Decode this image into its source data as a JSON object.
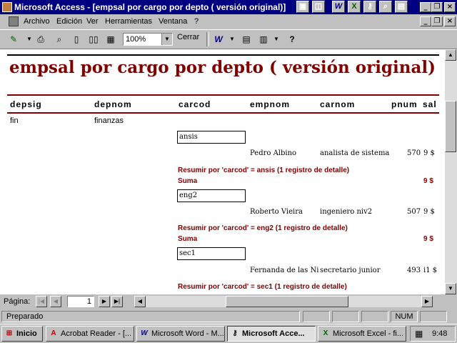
{
  "window": {
    "title": "Microsoft Access - [empsal por cargo por depto ( versión original)]",
    "tray_icons": [
      "W",
      "X",
      "",
      "",
      ""
    ]
  },
  "menu": {
    "items": [
      "Archivo",
      "Edición",
      "Ver",
      "Herramientas",
      "Ventana",
      "?"
    ],
    "underline": [
      "A",
      "E",
      "V",
      "H",
      "n",
      "?"
    ]
  },
  "toolbar": {
    "zoom_value": "100%",
    "close_label": "Cerrar"
  },
  "report": {
    "title": "empsal por cargo por depto ( versión original)",
    "columns": [
      "depsig",
      "depnom",
      "carcod",
      "empnom",
      "carnom",
      "pnum",
      "sal"
    ],
    "dept": {
      "depsig": "fin",
      "depnom": "finanzas"
    },
    "groups": [
      {
        "carcod": "ansis",
        "empnom": "Pedro Albino",
        "carnom": "analista de sistema",
        "pnum": "570",
        "sal": "9 $",
        "summary": "Resumir por 'carcod' =  ansis (1 registro de detalle)",
        "sum_label": "Suma",
        "sum_value": "9 $"
      },
      {
        "carcod": "eng2",
        "empnom": "Roberto Vieira",
        "carnom": "ingeniero niv2",
        "pnum": "507",
        "sal": "9 $",
        "summary": "Resumir por 'carcod' =  eng2 (1 registro de detalle)",
        "sum_label": "Suma",
        "sum_value": "9 $"
      },
      {
        "carcod": "sec1",
        "empnom": "Fernanda de las Ni",
        "carnom": "secretario junior",
        "pnum": "493",
        "sal": "i1 $",
        "summary": "Resumir por 'carcod' =  sec1 (1 registro de detalle)"
      }
    ]
  },
  "navigation": {
    "page_label": "Página:",
    "page_value": "1"
  },
  "status": {
    "text": "Preparado",
    "num": "NUM"
  },
  "taskbar": {
    "start_label": "Inicio",
    "tasks": [
      {
        "label": "Acrobat Reader - [...",
        "icon": "A"
      },
      {
        "label": "Microsoft Word - M...",
        "icon": "W"
      },
      {
        "label": "Microsoft Acce...",
        "icon": ""
      },
      {
        "label": "Microsoft Excel - fi...",
        "icon": "X"
      }
    ],
    "clock": "9:48"
  },
  "colors": {
    "title_bar": "#000080",
    "report_title": "#800000",
    "summary_text": "#800000"
  }
}
